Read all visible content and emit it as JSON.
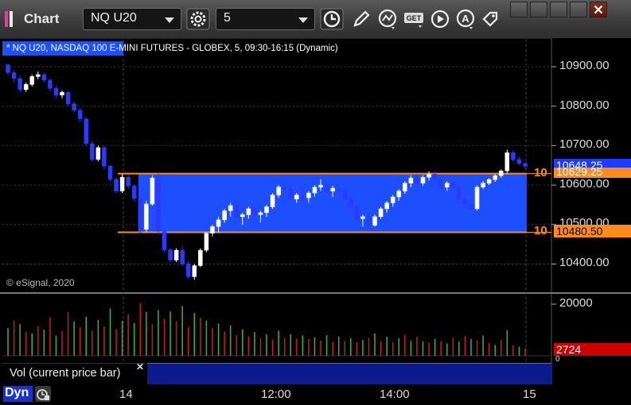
{
  "toolbar": {
    "title": "Chart",
    "symbol": "NQ U20",
    "interval": "5",
    "icons": [
      "settings-gear-icon",
      "clock-icon",
      "pencil-icon",
      "studies-icon",
      "get-icon",
      "play-icon",
      "alert-a-icon",
      "tag-icon"
    ]
  },
  "chart": {
    "description": "* NQ U20, NASDAQ 100 E-MINI FUTURES - GLOBEX, 5, 09:30-16:15 (Dynamic)",
    "copyright": "© eSignal, 2020",
    "price_axis": [
      "10900.00",
      "10800.00",
      "10700.00",
      "10600.00",
      "10500.00",
      "10400.00"
    ],
    "time_axis": [
      "14",
      "12:00",
      "14:00",
      "15"
    ],
    "last_price_tag": "10648.25",
    "level_upper_tag": "10629.25",
    "level_lower_tag": "10480.50",
    "level_label": "10",
    "volume_axis": [
      "20000",
      "0"
    ],
    "volume_tag": "2724",
    "volume_panel_label": "Vol (current price bar)",
    "bottom_label": "Dyn"
  },
  "colors": {
    "up": "#ffffff",
    "down": "#2a3aff",
    "band": "#1e4fff",
    "level_line": "#ff8c1a",
    "vol_up": "#3ab53a",
    "vol_down": "#d01a1a",
    "tag_blue": "#1e3cff",
    "tag_red": "#cc0000"
  },
  "chart_data": {
    "type": "candlestick",
    "y_unit": "price",
    "ylim": [
      10340,
      10950
    ],
    "levels": [
      10629.25,
      10480.5
    ],
    "last": 10648.25,
    "volume_last": 2724,
    "volume_ylim": [
      0,
      20000
    ],
    "candles": [
      [
        10905,
        10908,
        10878,
        10885
      ],
      [
        10885,
        10892,
        10860,
        10870
      ],
      [
        10870,
        10878,
        10835,
        10842
      ],
      [
        10842,
        10860,
        10836,
        10855
      ],
      [
        10855,
        10880,
        10850,
        10875
      ],
      [
        10875,
        10888,
        10868,
        10880
      ],
      [
        10880,
        10885,
        10860,
        10866
      ],
      [
        10866,
        10870,
        10838,
        10845
      ],
      [
        10845,
        10850,
        10820,
        10828
      ],
      [
        10828,
        10840,
        10820,
        10835
      ],
      [
        10835,
        10838,
        10800,
        10806
      ],
      [
        10806,
        10812,
        10785,
        10790
      ],
      [
        10790,
        10795,
        10760,
        10768
      ],
      [
        10768,
        10772,
        10700,
        10705
      ],
      [
        10705,
        10712,
        10660,
        10665
      ],
      [
        10665,
        10700,
        10660,
        10695
      ],
      [
        10695,
        10700,
        10640,
        10648
      ],
      [
        10648,
        10652,
        10610,
        10615
      ],
      [
        10615,
        10620,
        10580,
        10585
      ],
      [
        10585,
        10628,
        10580,
        10620
      ],
      [
        10620,
        10625,
        10590,
        10598
      ],
      [
        10598,
        10602,
        10560,
        10566
      ],
      [
        10566,
        10570,
        10478,
        10488
      ],
      [
        10488,
        10560,
        10480,
        10552
      ],
      [
        10552,
        10625,
        10548,
        10618
      ],
      [
        10618,
        10630,
        10475,
        10483
      ],
      [
        10483,
        10488,
        10430,
        10436
      ],
      [
        10436,
        10440,
        10405,
        10410
      ],
      [
        10410,
        10440,
        10405,
        10435
      ],
      [
        10435,
        10445,
        10395,
        10400
      ],
      [
        10400,
        10408,
        10362,
        10368
      ],
      [
        10368,
        10400,
        10360,
        10396
      ],
      [
        10396,
        10440,
        10392,
        10435
      ],
      [
        10435,
        10480,
        10430,
        10478
      ],
      [
        10478,
        10500,
        10470,
        10495
      ],
      [
        10495,
        10520,
        10480,
        10512
      ],
      [
        10512,
        10540,
        10505,
        10535
      ],
      [
        10535,
        10555,
        10520,
        10548
      ],
      [
        10548,
        10560,
        10512,
        10520
      ],
      [
        10520,
        10530,
        10500,
        10525
      ],
      [
        10525,
        10545,
        10515,
        10540
      ],
      [
        10540,
        10548,
        10520,
        10525
      ],
      [
        10525,
        10535,
        10505,
        10530
      ],
      [
        10530,
        10550,
        10520,
        10545
      ],
      [
        10545,
        10580,
        10540,
        10575
      ],
      [
        10575,
        10600,
        10568,
        10595
      ],
      [
        10595,
        10610,
        10585,
        10590
      ],
      [
        10590,
        10600,
        10560,
        10565
      ],
      [
        10565,
        10580,
        10555,
        10575
      ],
      [
        10575,
        10590,
        10560,
        10568
      ],
      [
        10568,
        10585,
        10555,
        10580
      ],
      [
        10580,
        10600,
        10570,
        10595
      ],
      [
        10595,
        10615,
        10585,
        10600
      ],
      [
        10600,
        10605,
        10580,
        10585
      ],
      [
        10585,
        10598,
        10570,
        10592
      ],
      [
        10592,
        10605,
        10580,
        10585
      ],
      [
        10585,
        10590,
        10560,
        10565
      ],
      [
        10565,
        10575,
        10540,
        10545
      ],
      [
        10545,
        10550,
        10510,
        10515
      ],
      [
        10515,
        10525,
        10495,
        10520
      ],
      [
        10520,
        10530,
        10490,
        10498
      ],
      [
        10498,
        10525,
        10495,
        10520
      ],
      [
        10520,
        10545,
        10515,
        10540
      ],
      [
        10540,
        10560,
        10530,
        10555
      ],
      [
        10555,
        10575,
        10545,
        10570
      ],
      [
        10570,
        10590,
        10560,
        10585
      ],
      [
        10585,
        10610,
        10578,
        10605
      ],
      [
        10605,
        10625,
        10595,
        10618
      ],
      [
        10618,
        10628,
        10600,
        10605
      ],
      [
        10605,
        10625,
        10598,
        10620
      ],
      [
        10620,
        10635,
        10612,
        10628
      ],
      [
        10628,
        10635,
        10610,
        10615
      ],
      [
        10615,
        10622,
        10590,
        10595
      ],
      [
        10595,
        10610,
        10585,
        10605
      ],
      [
        10605,
        10612,
        10590,
        10595
      ],
      [
        10595,
        10600,
        10560,
        10565
      ],
      [
        10565,
        10572,
        10545,
        10552
      ],
      [
        10552,
        10560,
        10535,
        10540
      ],
      [
        10540,
        10600,
        10535,
        10595
      ],
      [
        10595,
        10610,
        10590,
        10605
      ],
      [
        10605,
        10618,
        10600,
        10614
      ],
      [
        10614,
        10628,
        10608,
        10624
      ],
      [
        10624,
        10640,
        10618,
        10636
      ],
      [
        10636,
        10690,
        10630,
        10682
      ],
      [
        10682,
        10688,
        10660,
        10665
      ],
      [
        10665,
        10672,
        10650,
        10655
      ],
      [
        10655,
        10660,
        10640,
        10648
      ]
    ],
    "volume": [
      [
        9800,
        1
      ],
      [
        12500,
        0
      ],
      [
        11200,
        1
      ],
      [
        8400,
        0
      ],
      [
        7900,
        1
      ],
      [
        10500,
        0
      ],
      [
        9300,
        1
      ],
      [
        13600,
        0
      ],
      [
        7200,
        1
      ],
      [
        8800,
        0
      ],
      [
        15600,
        0
      ],
      [
        12200,
        1
      ],
      [
        10100,
        0
      ],
      [
        13900,
        1
      ],
      [
        8900,
        0
      ],
      [
        12700,
        1
      ],
      [
        10400,
        0
      ],
      [
        16800,
        1
      ],
      [
        9400,
        0
      ],
      [
        12300,
        1
      ],
      [
        14800,
        0
      ],
      [
        11600,
        1
      ],
      [
        18700,
        0
      ],
      [
        15500,
        1
      ],
      [
        11200,
        0
      ],
      [
        16200,
        1
      ],
      [
        13100,
        0
      ],
      [
        15700,
        1
      ],
      [
        12300,
        0
      ],
      [
        17600,
        1
      ],
      [
        10300,
        0
      ],
      [
        15200,
        1
      ],
      [
        13500,
        0
      ],
      [
        12500,
        1
      ],
      [
        9800,
        0
      ],
      [
        11400,
        1
      ],
      [
        8600,
        0
      ],
      [
        10700,
        1
      ],
      [
        7300,
        0
      ],
      [
        9400,
        1
      ],
      [
        6900,
        0
      ],
      [
        8400,
        1
      ],
      [
        6300,
        0
      ],
      [
        7600,
        1
      ],
      [
        5800,
        0
      ],
      [
        8900,
        1
      ],
      [
        6400,
        0
      ],
      [
        7700,
        1
      ],
      [
        6100,
        0
      ],
      [
        7200,
        1
      ],
      [
        5900,
        0
      ],
      [
        6600,
        1
      ],
      [
        5400,
        0
      ],
      [
        7300,
        1
      ],
      [
        4900,
        0
      ],
      [
        6800,
        1
      ],
      [
        5300,
        0
      ],
      [
        6200,
        1
      ],
      [
        4800,
        0
      ],
      [
        5600,
        1
      ],
      [
        6400,
        0
      ],
      [
        7900,
        1
      ],
      [
        5200,
        0
      ],
      [
        6700,
        1
      ],
      [
        4800,
        0
      ],
      [
        6200,
        1
      ],
      [
        7400,
        0
      ],
      [
        5400,
        1
      ],
      [
        6700,
        0
      ],
      [
        5100,
        1
      ],
      [
        4700,
        0
      ],
      [
        6000,
        1
      ],
      [
        5200,
        0
      ],
      [
        4400,
        1
      ],
      [
        6300,
        0
      ],
      [
        5000,
        1
      ],
      [
        7000,
        0
      ],
      [
        6000,
        1
      ],
      [
        5500,
        0
      ],
      [
        7200,
        1
      ],
      [
        4600,
        0
      ],
      [
        3800,
        1
      ],
      [
        5600,
        0
      ],
      [
        9100,
        1
      ],
      [
        3700,
        0
      ],
      [
        3200,
        1
      ],
      [
        2724,
        0
      ]
    ]
  }
}
